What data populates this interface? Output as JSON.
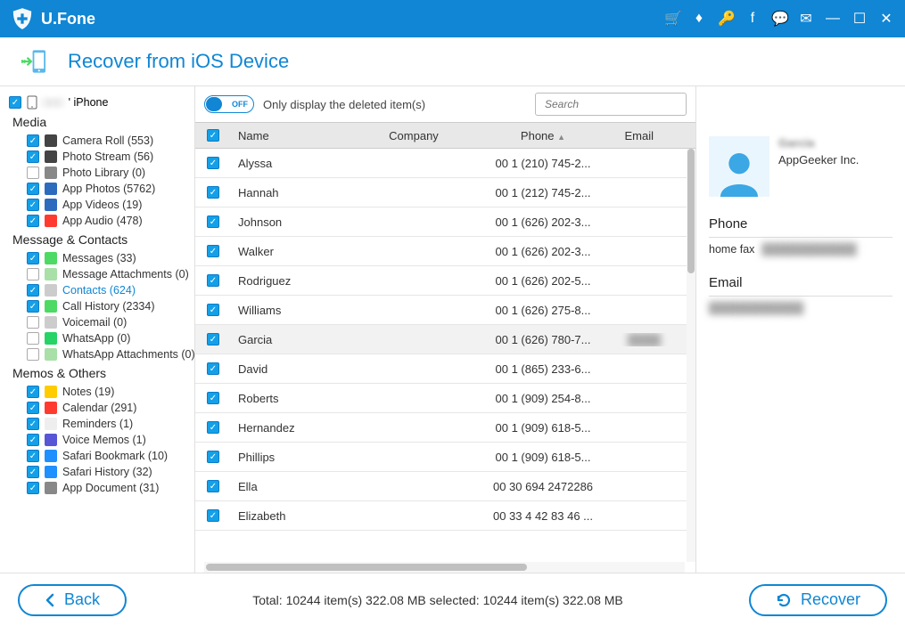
{
  "app_name": "U.Fone",
  "page_title": "Recover from iOS Device",
  "device_name": "' iPhone",
  "toggle": {
    "state": "OFF",
    "label": "Only display the deleted item(s)"
  },
  "search": {
    "placeholder": "Search"
  },
  "sidebar": {
    "sections": [
      {
        "title": "Media",
        "items": [
          {
            "label": "Camera Roll (553)",
            "checked": true,
            "icon_bg": "#444"
          },
          {
            "label": "Photo Stream (56)",
            "checked": true,
            "icon_bg": "#444"
          },
          {
            "label": "Photo Library (0)",
            "checked": false,
            "icon_bg": "#888"
          },
          {
            "label": "App Photos (5762)",
            "checked": true,
            "icon_bg": "#2d6bbf"
          },
          {
            "label": "App Videos (19)",
            "checked": true,
            "icon_bg": "#2d6bbf"
          },
          {
            "label": "App Audio (478)",
            "checked": true,
            "icon_bg": "#ff3b30"
          }
        ]
      },
      {
        "title": "Message & Contacts",
        "items": [
          {
            "label": "Messages (33)",
            "checked": true,
            "icon_bg": "#4cd964"
          },
          {
            "label": "Message Attachments (0)",
            "checked": false,
            "icon_bg": "#a8e0a8"
          },
          {
            "label": "Contacts (624)",
            "checked": true,
            "icon_bg": "#ccc",
            "active": true
          },
          {
            "label": "Call History (2334)",
            "checked": true,
            "icon_bg": "#4cd964"
          },
          {
            "label": "Voicemail (0)",
            "checked": false,
            "icon_bg": "#ccc"
          },
          {
            "label": "WhatsApp (0)",
            "checked": false,
            "icon_bg": "#25d366"
          },
          {
            "label": "WhatsApp Attachments (0)",
            "checked": false,
            "icon_bg": "#a8e0a8"
          }
        ]
      },
      {
        "title": "Memos & Others",
        "items": [
          {
            "label": "Notes (19)",
            "checked": true,
            "icon_bg": "#ffcc00"
          },
          {
            "label": "Calendar (291)",
            "checked": true,
            "icon_bg": "#ff3b30"
          },
          {
            "label": "Reminders (1)",
            "checked": true,
            "icon_bg": "#eee"
          },
          {
            "label": "Voice Memos (1)",
            "checked": true,
            "icon_bg": "#5856d6"
          },
          {
            "label": "Safari Bookmark (10)",
            "checked": true,
            "icon_bg": "#1e90ff"
          },
          {
            "label": "Safari History (32)",
            "checked": true,
            "icon_bg": "#1e90ff"
          },
          {
            "label": "App Document (31)",
            "checked": true,
            "icon_bg": "#888"
          }
        ]
      }
    ]
  },
  "table": {
    "headers": {
      "name": "Name",
      "company": "Company",
      "phone": "Phone",
      "email": "Email"
    },
    "rows": [
      {
        "name": "Alyssa",
        "company": "",
        "phone": "00 1 (210) 745-2...",
        "email": ""
      },
      {
        "name": "Hannah",
        "company": "",
        "phone": "00 1 (212) 745-2...",
        "email": ""
      },
      {
        "name": "Johnson",
        "company": "",
        "phone": "00 1 (626) 202-3...",
        "email": ""
      },
      {
        "name": "Walker",
        "company": "",
        "phone": "00 1 (626) 202-3...",
        "email": ""
      },
      {
        "name": "Rodriguez",
        "company": "",
        "phone": "00 1 (626) 202-5...",
        "email": ""
      },
      {
        "name": "Williams",
        "company": "",
        "phone": "00 1 (626) 275-8...",
        "email": ""
      },
      {
        "name": "Garcia",
        "company": "",
        "phone": "00 1 (626) 780-7...",
        "email": "",
        "selected": true
      },
      {
        "name": "David",
        "company": "",
        "phone": "00 1 (865) 233-6...",
        "email": ""
      },
      {
        "name": "Roberts",
        "company": "",
        "phone": "00 1 (909) 254-8...",
        "email": ""
      },
      {
        "name": "Hernandez",
        "company": "",
        "phone": "00 1 (909) 618-5...",
        "email": ""
      },
      {
        "name": "Phillips",
        "company": "",
        "phone": "00 1 (909) 618-5...",
        "email": ""
      },
      {
        "name": "Ella",
        "company": "",
        "phone": "00 30 694 2472286",
        "email": ""
      },
      {
        "name": "Elizabeth",
        "company": "",
        "phone": "00 33 4 42 83 46 ...",
        "email": ""
      }
    ]
  },
  "detail": {
    "name": "Garcia",
    "company": "AppGeeker Inc.",
    "phone_header": "Phone",
    "phone_label": "home fax",
    "phone_value": "",
    "email_header": "Email",
    "email_value": ""
  },
  "footer": {
    "back": "Back",
    "recover": "Recover",
    "status": "Total: 10244 item(s) 322.08 MB    selected: 10244 item(s) 322.08 MB"
  }
}
